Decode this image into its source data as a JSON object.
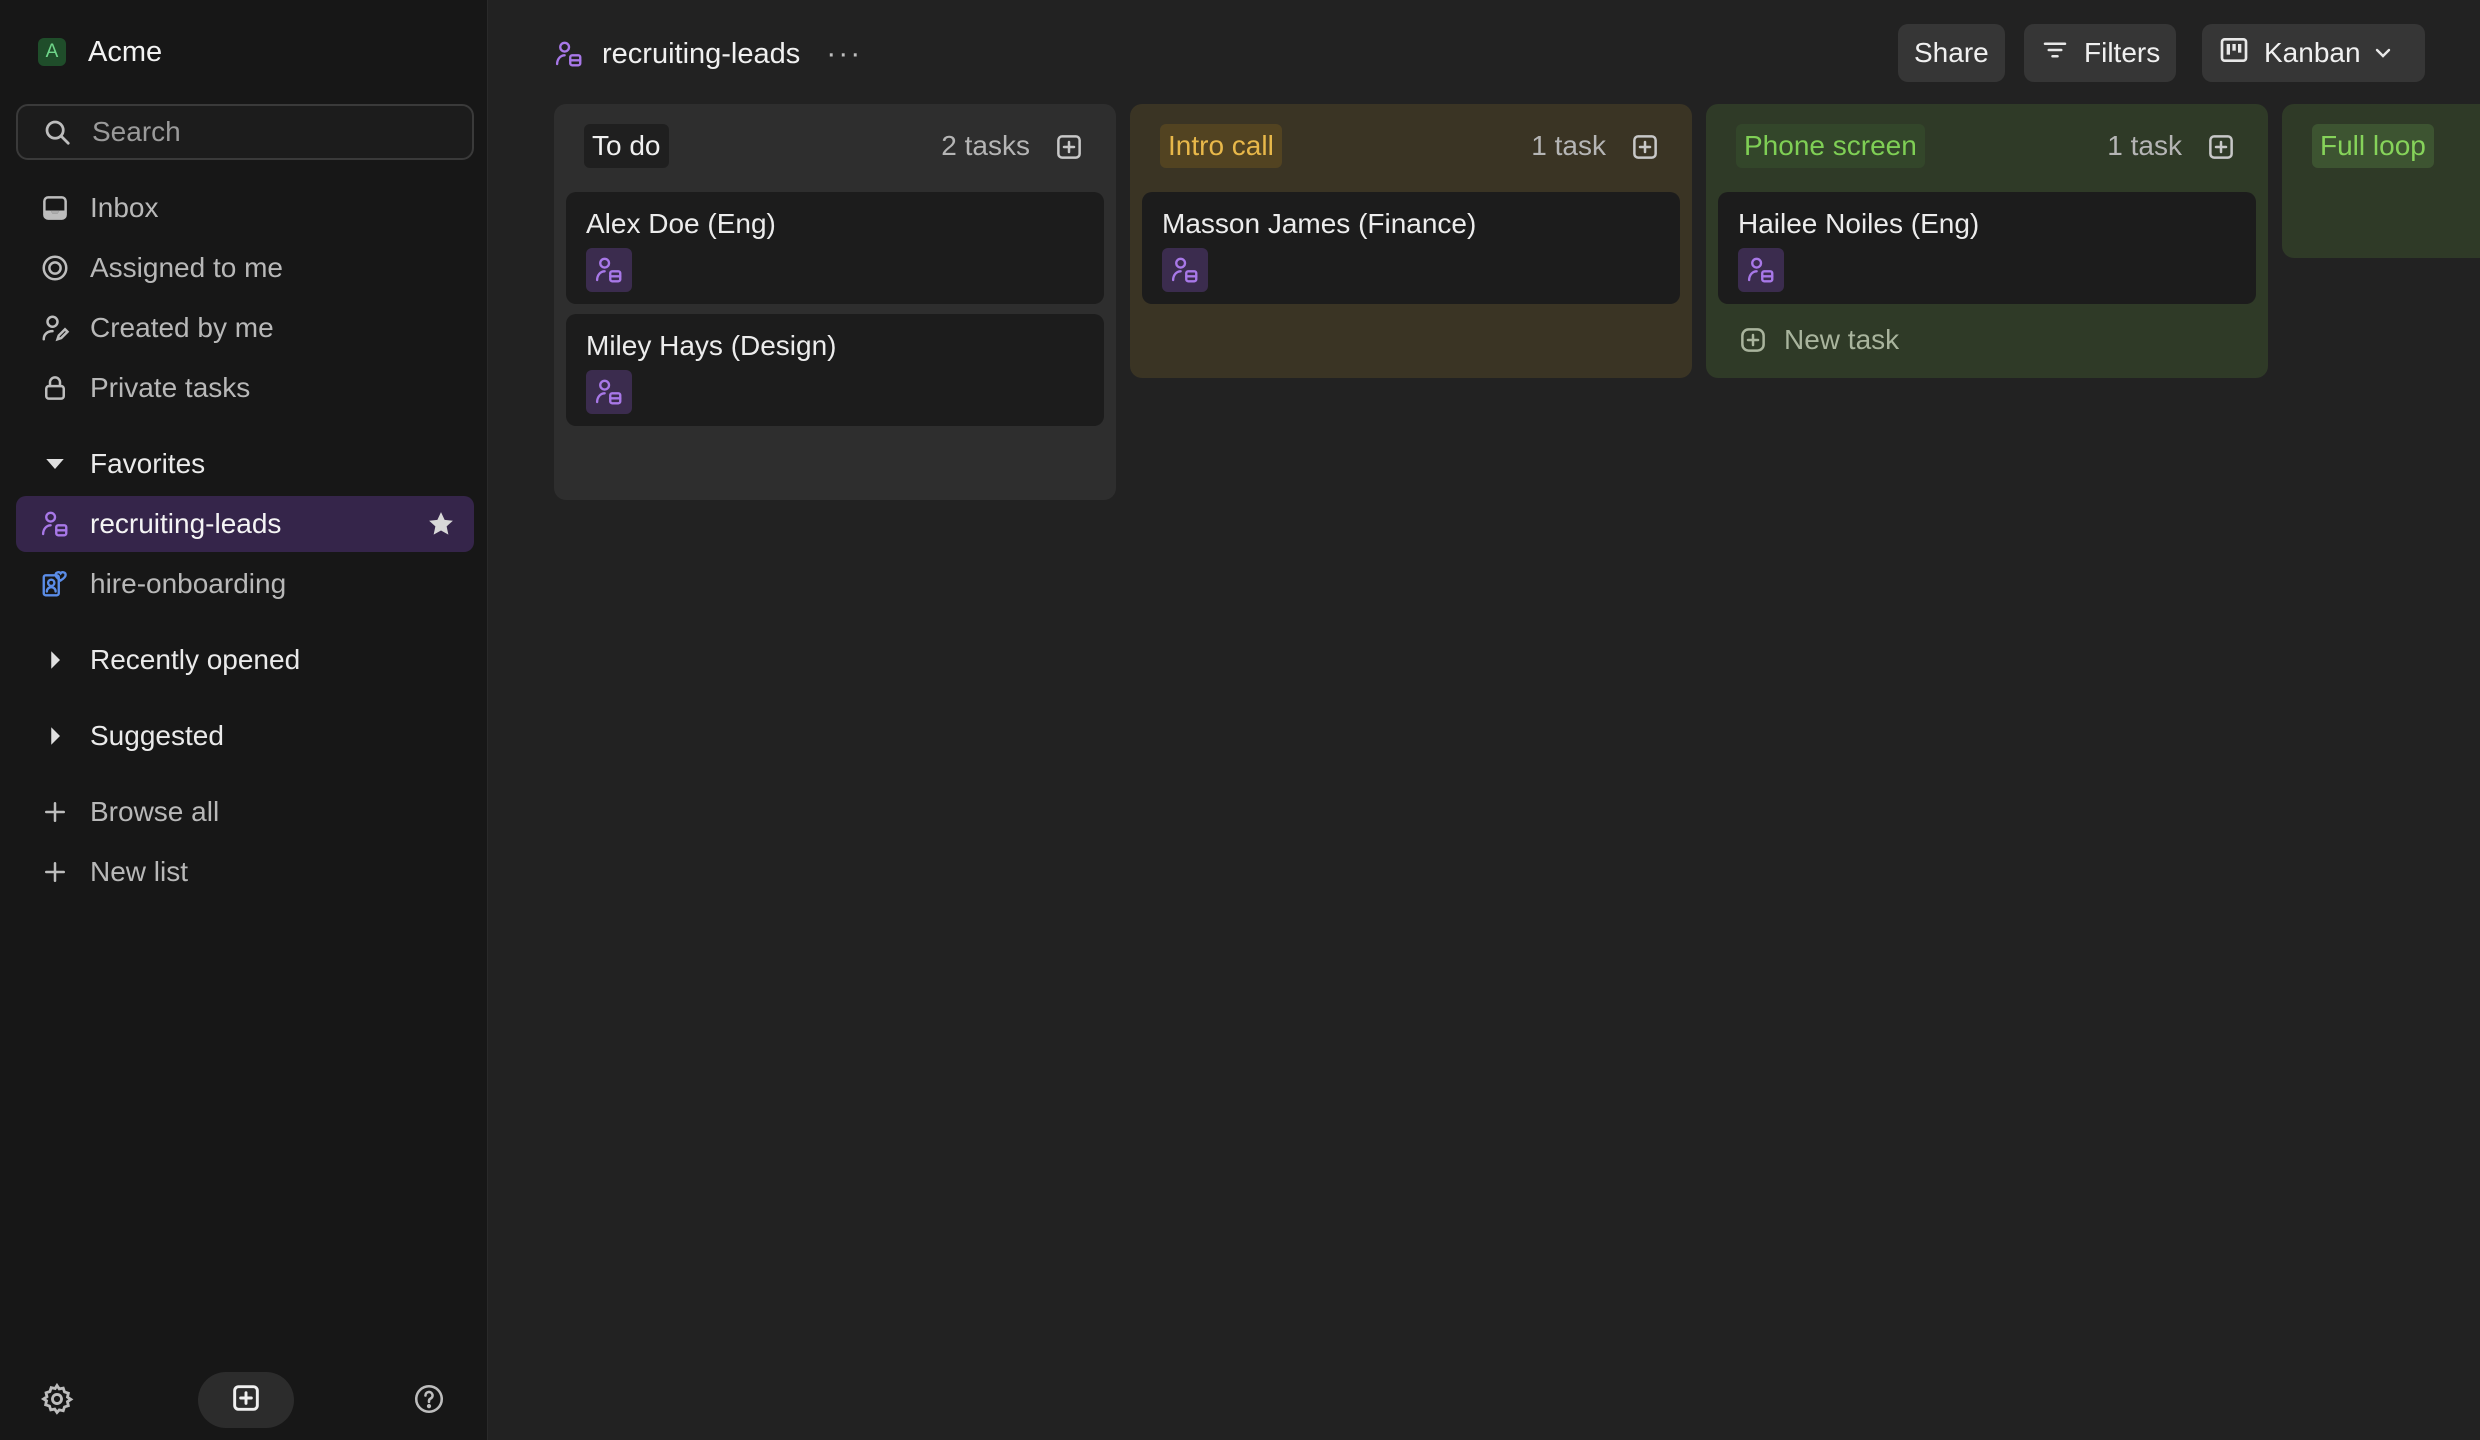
{
  "workspace": {
    "initial": "A",
    "name": "Acme"
  },
  "search": {
    "placeholder": "Search"
  },
  "nav": {
    "inbox": "Inbox",
    "assigned": "Assigned to me",
    "created": "Created by me",
    "private": "Private tasks"
  },
  "favorites": {
    "label": "Favorites",
    "items": [
      {
        "label": "recruiting-leads",
        "icon": "recruiting-icon",
        "starred": true
      },
      {
        "label": "hire-onboarding",
        "icon": "onboarding-icon"
      }
    ]
  },
  "recently_opened": "Recently opened",
  "suggested": "Suggested",
  "browse_all": "Browse all",
  "new_list": "New list",
  "page": {
    "title": "recruiting-leads",
    "more": "···"
  },
  "toolbar": {
    "share": "Share",
    "filters": "Filters",
    "view": "Kanban"
  },
  "columns": [
    {
      "name": "To do",
      "count": "2 tasks",
      "tag_bg": "#1f1f1f",
      "tag_color": "#f0f0f0",
      "bg": "#2e2e2e",
      "cards": [
        {
          "title": "Alex Doe (Eng)"
        },
        {
          "title": "Miley Hays (Design)"
        }
      ]
    },
    {
      "name": "Intro call",
      "count": "1 task",
      "tag_bg": "#524321",
      "tag_color": "#e8b84a",
      "bg": "#3a3424",
      "cards": [
        {
          "title": "Masson James (Finance)"
        }
      ]
    },
    {
      "name": "Phone screen",
      "count": "1 task",
      "tag_bg": "#33462a",
      "tag_color": "#7fcf55",
      "bg": "#2f3a27",
      "cards": [
        {
          "title": "Hailee Noiles (Eng)"
        }
      ],
      "new_task": "New task"
    },
    {
      "name": "Full loop",
      "tag_bg": "#3d5431",
      "tag_color": "#86d35a",
      "bg": "#2f3a27"
    }
  ],
  "colors": {
    "accent": "#9b6bd6",
    "card": "#1c1c1c"
  }
}
